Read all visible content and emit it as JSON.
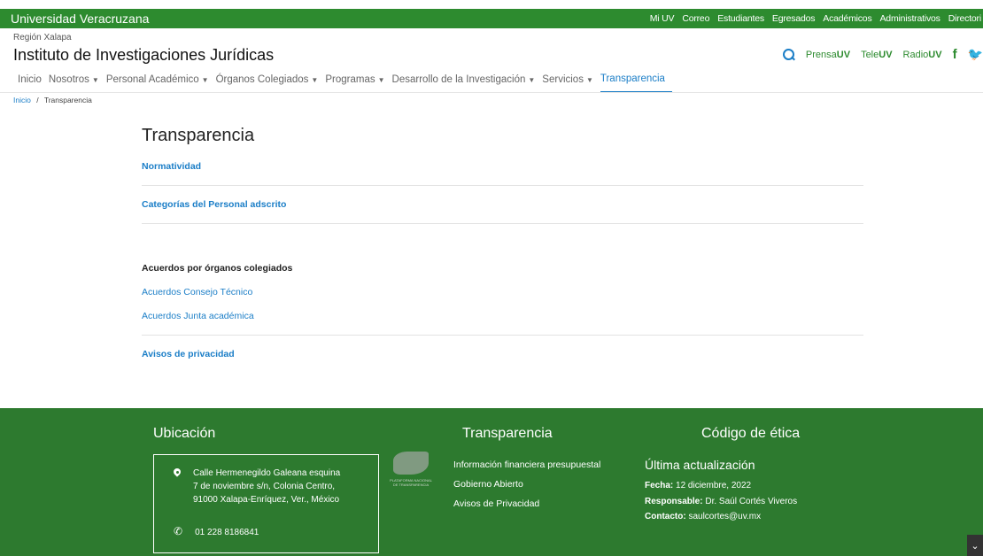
{
  "topbar": {
    "brand": "Universidad Veracruzana",
    "links": [
      "Mi UV",
      "Correo",
      "Estudiantes",
      "Egresados",
      "Académicos",
      "Administrativos",
      "Directori"
    ]
  },
  "header": {
    "region": "Región Xalapa",
    "title": "Instituto de Investigaciones Jurídicas",
    "social": {
      "prensa": "Prensa",
      "tele": "Tele",
      "radio": "Radio",
      "uv": "UV"
    }
  },
  "nav": {
    "items": [
      {
        "label": "Inicio",
        "caret": false
      },
      {
        "label": "Nosotros",
        "caret": true
      },
      {
        "label": "Personal Académico",
        "caret": true
      },
      {
        "label": "Órganos Colegiados",
        "caret": true
      },
      {
        "label": "Programas",
        "caret": true
      },
      {
        "label": "Desarrollo de la Investigación",
        "caret": true
      },
      {
        "label": "Servicios",
        "caret": true
      },
      {
        "label": "Transparencia",
        "caret": false,
        "active": true
      }
    ]
  },
  "breadcrumb": {
    "home": "Inicio",
    "sep": "/",
    "current": "Transparencia"
  },
  "main": {
    "title": "Transparencia",
    "normatividad": "Normatividad",
    "categorias": "Categorías del Personal adscrito",
    "acuerdos_head": "Acuerdos por órganos colegiados",
    "acuerdo_consejo": "Acuerdos Consejo Técnico",
    "acuerdo_junta": "Acuerdos Junta académica",
    "avisos": "Avisos de privacidad"
  },
  "footer": {
    "ubicacion": {
      "title": "Ubicación",
      "address": [
        "Calle Hermenegildo Galeana esquina",
        "7 de noviembre s/n, Colonia Centro,",
        "91000 Xalapa-Enríquez, Ver., México"
      ],
      "phone": "01 228 8186841"
    },
    "transparencia": {
      "title": "Transparencia",
      "logo_text": "PLATAFORMA NACIONAL DE TRANSPARENCIA",
      "links": [
        "Información financiera presupuestal",
        "Gobierno Abierto",
        "Avisos de Privacidad"
      ]
    },
    "codigo": {
      "title": "Código de ética",
      "subtitle": "Última actualización",
      "fecha_label": "Fecha:",
      "fecha": "12 diciembre, 2022",
      "resp_label": "Responsable:",
      "resp": "Dr. Saúl Cortés Viveros",
      "contacto_label": "Contacto:",
      "contacto": "saulcortes@uv.mx"
    }
  },
  "colors": {
    "green_top": "#2d8b2f",
    "green_footer": "#2d7a2f",
    "link_blue": "#1b7ec7"
  }
}
